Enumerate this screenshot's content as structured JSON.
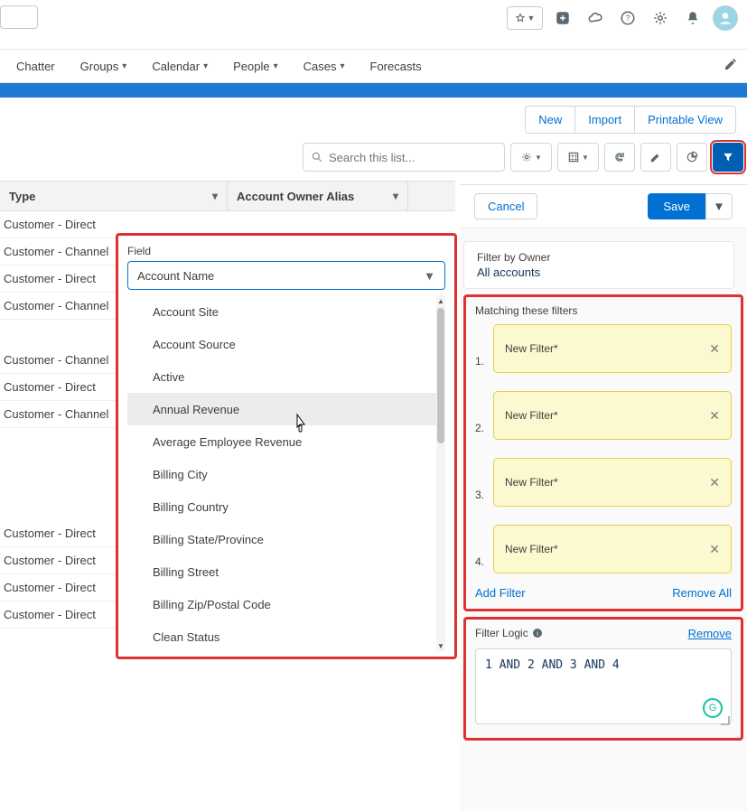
{
  "nav": {
    "items": [
      "Chatter",
      "Groups",
      "Calendar",
      "People",
      "Cases",
      "Forecasts"
    ],
    "dropdown_for": [
      false,
      true,
      true,
      true,
      true,
      false
    ]
  },
  "actions": {
    "new": "New",
    "import": "Import",
    "printable": "Printable View"
  },
  "search": {
    "placeholder": "Search this list..."
  },
  "columns": {
    "c1": "Type",
    "c2": "Account Owner Alias"
  },
  "rows_top": [
    "Customer - Direct",
    "Customer - Channel",
    "Customer - Direct",
    "Customer - Channel",
    "",
    "Customer - Channel",
    "Customer - Direct",
    "Customer - Channel"
  ],
  "rows_bottom": [
    "Customer - Direct",
    "Customer - Direct",
    "Customer - Direct",
    "Customer - Direct"
  ],
  "field_picker": {
    "label": "Field",
    "selected": "Account Name",
    "options": [
      "Account Site",
      "Account Source",
      "Active",
      "Annual Revenue",
      "Average Employee Revenue",
      "Billing City",
      "Billing Country",
      "Billing State/Province",
      "Billing Street",
      "Billing Zip/Postal Code",
      "Clean Status"
    ],
    "hover_index": 3
  },
  "panel": {
    "cancel": "Cancel",
    "save": "Save",
    "owner_label": "Filter by Owner",
    "owner_value": "All accounts",
    "match_heading": "Matching these filters",
    "filters": [
      {
        "label": "New Filter*"
      },
      {
        "label": "New Filter*"
      },
      {
        "label": "New Filter*"
      },
      {
        "label": "New Filter*"
      }
    ],
    "add_filter": "Add Filter",
    "remove_all": "Remove All",
    "logic_heading": "Filter Logic",
    "logic_remove": "Remove",
    "logic_value": "1 AND 2 AND 3 AND 4"
  }
}
